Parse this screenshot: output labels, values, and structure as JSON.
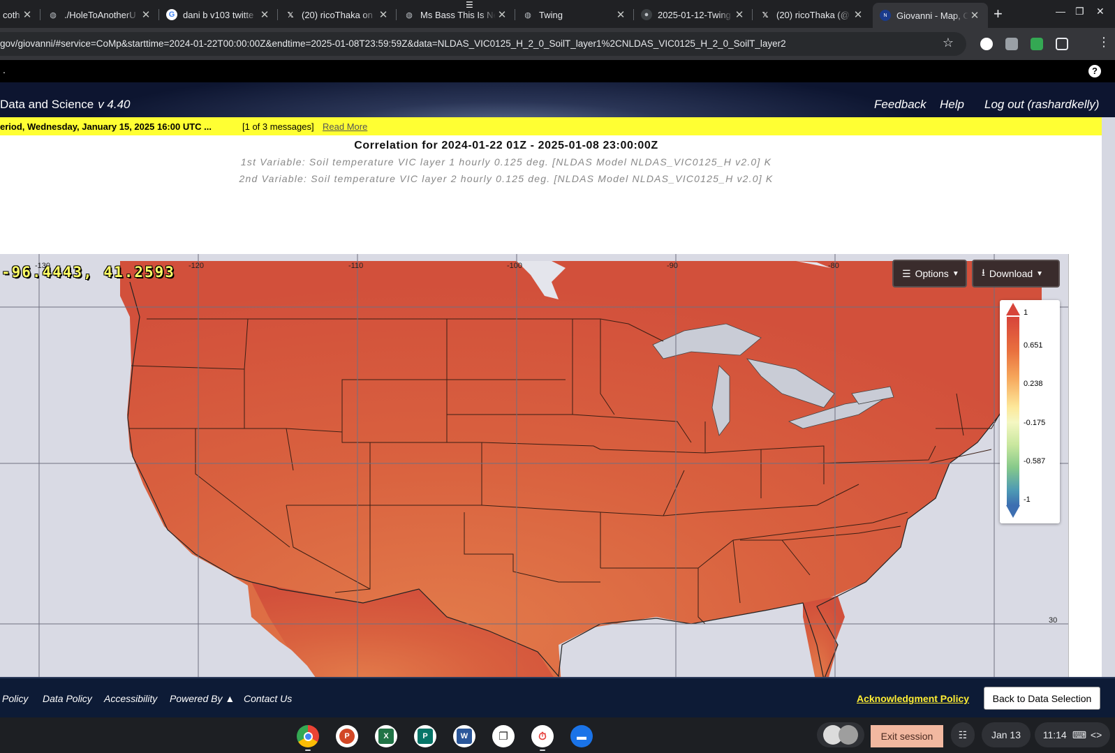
{
  "browser": {
    "tabs": [
      {
        "title": "coth",
        "icon": "tab-favicon"
      },
      {
        "title": "./HoleToAnotherU",
        "icon": "globe-icon"
      },
      {
        "title": "dani b v103 twitte",
        "icon": "google-icon"
      },
      {
        "title": "(20) ricoThaka on",
        "icon": "x-icon"
      },
      {
        "title": "Ms Bass This Is Ne",
        "icon": "globe-icon"
      },
      {
        "title": "Twing",
        "icon": "globe-icon"
      },
      {
        "title": "2025-01-12-Twing",
        "icon": "github-icon"
      },
      {
        "title": "(20) ricoThaka (@",
        "icon": "x-icon"
      },
      {
        "title": "Giovanni - Map, Co",
        "icon": "nasa-icon",
        "active": true
      }
    ],
    "new_tab_label": "+",
    "url": "gov/giovanni/#service=CoMp&starttime=2024-01-22T00:00:00Z&endtime=2025-01-08T23:59:59Z&data=NLDAS_VIC0125_H_2_0_SoilT_layer1%2CNLDAS_VIC0125_H_2_0_SoilT_layer2"
  },
  "header": {
    "top_dot": ".",
    "help_glyph": "?",
    "app_title": "Data and Science",
    "version": "v 4.40",
    "nav": [
      "Feedback",
      "Help",
      "Log out (rashardkelly)"
    ]
  },
  "alert": {
    "text": "eriod, Wednesday, January 15, 2025 16:00 UTC ...",
    "count": "[1 of 3 messages]",
    "read_more": "Read More"
  },
  "plot": {
    "title": "Correlation for 2024-01-22 01Z - 2025-01-08 23:00:00Z",
    "var1": "1st Variable: Soil temperature VIC layer 1 hourly 0.125 deg. [NLDAS Model NLDAS_VIC0125_H v2.0] K",
    "var2": "2nd Variable: Soil temperature VIC layer 2 hourly 0.125 deg. [NLDAS Model NLDAS_VIC0125_H v2.0] K",
    "cursor_coord": "-96.4443, 41.2593",
    "options_label": "Options",
    "download_label": "Download",
    "lon_ticks": [
      "-130",
      "-120",
      "-110",
      "-100",
      "-90",
      "-80"
    ],
    "lat_ticks": [
      "30"
    ],
    "legend_labels": [
      "1",
      "0.651",
      "0.238",
      "-0.175",
      "-0.587",
      "-1"
    ],
    "colors": {
      "high": "#d7443a",
      "mid": "#f4f7c2",
      "low": "#3d6fb1",
      "data_fill": "#d65a3f"
    }
  },
  "footer": {
    "links": [
      "Policy",
      "Data Policy",
      "Accessibility",
      "Powered By ▲",
      "Contact Us"
    ],
    "ack": "Acknowledgment Policy",
    "back": "Back to Data Selection"
  },
  "shelf": {
    "apps": [
      "chrome-icon",
      "powerpoint-icon",
      "excel-icon",
      "publisher-icon",
      "word-icon",
      "files-icon",
      "timer-icon",
      "folder-icon"
    ],
    "exit_label": "Exit session",
    "date": "Jan 13",
    "time": "11:14"
  }
}
